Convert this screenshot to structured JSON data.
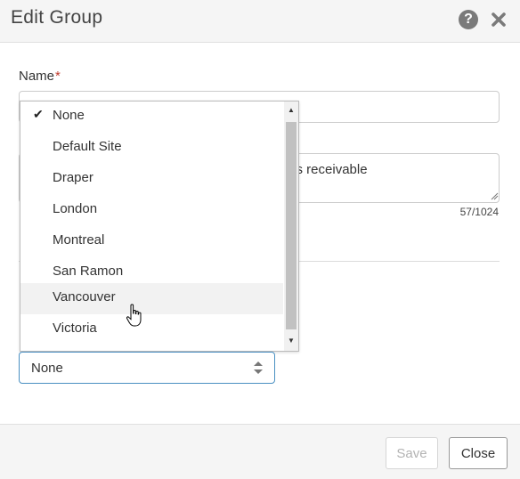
{
  "dialog": {
    "title": "Edit Group",
    "help_icon": "question-circle-icon",
    "close_icon": "close-x-icon"
  },
  "form": {
    "name_label": "Name",
    "name_required_mark": "*",
    "name_value": "",
    "description_visible_text": "nts receivable",
    "description_char_count": "57/1024"
  },
  "dropdown": {
    "selected": "None",
    "options": [
      {
        "label": "None",
        "checked": true
      },
      {
        "label": "Default Site",
        "checked": false
      },
      {
        "label": "Draper",
        "checked": false
      },
      {
        "label": "London",
        "checked": false
      },
      {
        "label": "Montreal",
        "checked": false
      },
      {
        "label": "San Ramon",
        "checked": false
      },
      {
        "label": "Vancouver",
        "checked": false,
        "hovered": true
      },
      {
        "label": "Victoria",
        "checked": false
      }
    ],
    "check_icon": "checkmark-icon"
  },
  "footer": {
    "save_label": "Save",
    "close_label": "Close",
    "save_disabled": true
  },
  "colors": {
    "header_bg": "#f5f5f5",
    "required": "#c0392b",
    "focus_border": "#4a90c2"
  }
}
